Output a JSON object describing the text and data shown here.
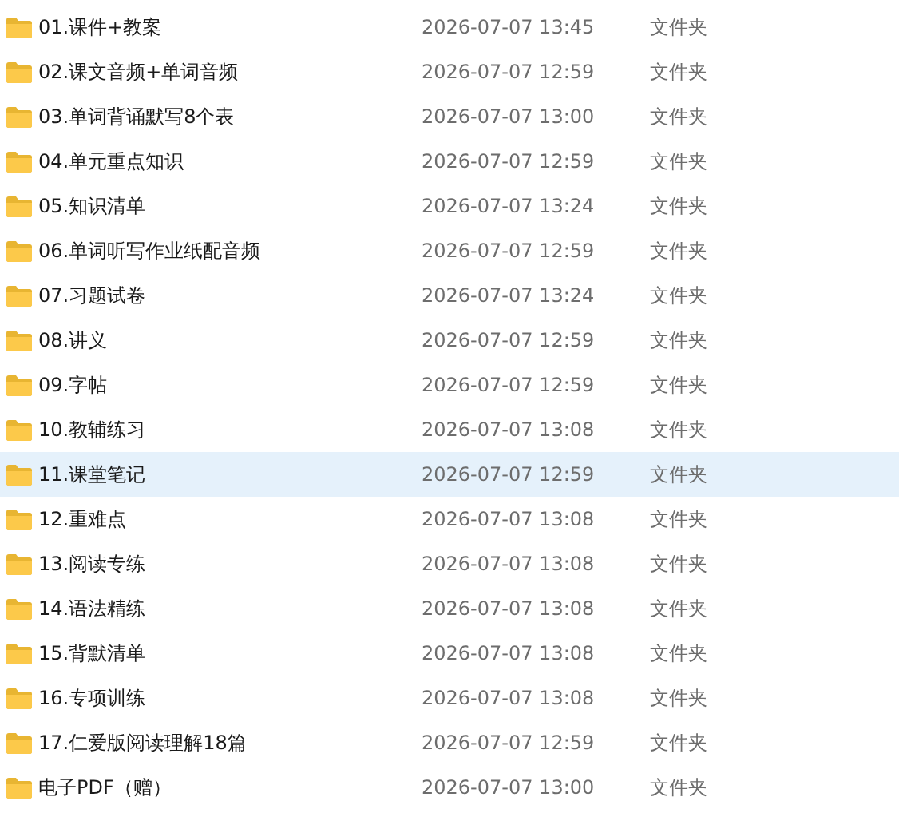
{
  "files": [
    {
      "name": "01.课件+教案",
      "modified": "2026-07-07 13:45",
      "type": "文件夹",
      "selected": false
    },
    {
      "name": "02.课文音频+单词音频",
      "modified": "2026-07-07 12:59",
      "type": "文件夹",
      "selected": false
    },
    {
      "name": "03.单词背诵默写8个表",
      "modified": "2026-07-07 13:00",
      "type": "文件夹",
      "selected": false
    },
    {
      "name": "04.单元重点知识",
      "modified": "2026-07-07 12:59",
      "type": "文件夹",
      "selected": false
    },
    {
      "name": "05.知识清单",
      "modified": "2026-07-07 13:24",
      "type": "文件夹",
      "selected": false
    },
    {
      "name": "06.单词听写作业纸配音频",
      "modified": "2026-07-07 12:59",
      "type": "文件夹",
      "selected": false
    },
    {
      "name": "07.习题试卷",
      "modified": "2026-07-07 13:24",
      "type": "文件夹",
      "selected": false
    },
    {
      "name": "08.讲义",
      "modified": "2026-07-07 12:59",
      "type": "文件夹",
      "selected": false
    },
    {
      "name": "09.字帖",
      "modified": "2026-07-07 12:59",
      "type": "文件夹",
      "selected": false
    },
    {
      "name": "10.教辅练习",
      "modified": "2026-07-07 13:08",
      "type": "文件夹",
      "selected": false
    },
    {
      "name": "11.课堂笔记",
      "modified": "2026-07-07 12:59",
      "type": "文件夹",
      "selected": true
    },
    {
      "name": "12.重难点",
      "modified": "2026-07-07 13:08",
      "type": "文件夹",
      "selected": false
    },
    {
      "name": "13.阅读专练",
      "modified": "2026-07-07 13:08",
      "type": "文件夹",
      "selected": false
    },
    {
      "name": "14.语法精练",
      "modified": "2026-07-07 13:08",
      "type": "文件夹",
      "selected": false
    },
    {
      "name": "15.背默清单",
      "modified": "2026-07-07 13:08",
      "type": "文件夹",
      "selected": false
    },
    {
      "name": "16.专项训练",
      "modified": "2026-07-07 13:08",
      "type": "文件夹",
      "selected": false
    },
    {
      "name": "17.仁爱版阅读理解18篇",
      "modified": "2026-07-07 12:59",
      "type": "文件夹",
      "selected": false
    },
    {
      "name": "电子PDF（赠）",
      "modified": "2026-07-07 13:00",
      "type": "文件夹",
      "selected": false
    }
  ]
}
